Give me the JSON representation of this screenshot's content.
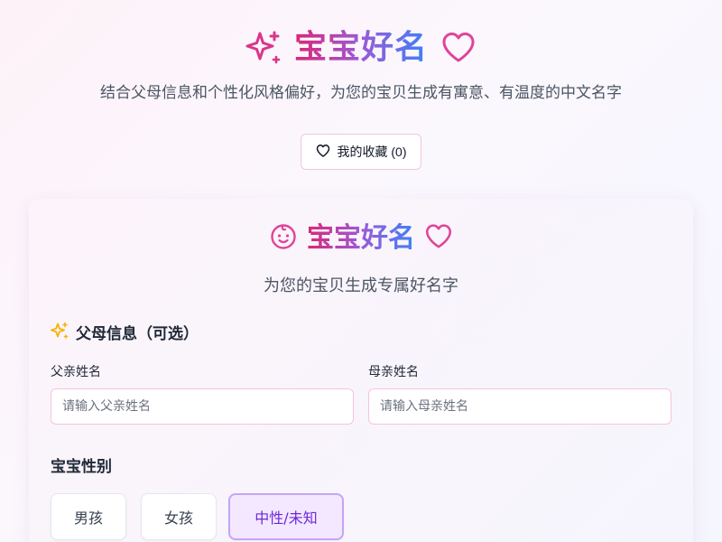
{
  "header": {
    "title": "宝宝好名",
    "subtitle": "结合父母信息和个性化风格偏好，为您的宝贝生成有寓意、有温度的中文名字",
    "favorites_label": "我的收藏 (0)"
  },
  "card": {
    "title": "宝宝好名",
    "subtitle": "为您的宝贝生成专属好名字",
    "parents_section": "父母信息（可选）",
    "father_label": "父亲姓名",
    "father_placeholder": "请输入父亲姓名",
    "father_value": "",
    "mother_label": "母亲姓名",
    "mother_placeholder": "请输入母亲姓名",
    "mother_value": "",
    "gender_section": "宝宝性别",
    "gender_options": [
      {
        "label": "男孩",
        "selected": false
      },
      {
        "label": "女孩",
        "selected": false
      },
      {
        "label": "中性/未知",
        "selected": true
      }
    ]
  },
  "colors": {
    "accent_pink": "#db2777",
    "accent_purple": "#9b5ad6",
    "accent_blue": "#3b82f6",
    "sparkle_yellow": "#f5b301",
    "selected_bg": "#f3e8ff",
    "selected_border": "#c4a5f5",
    "selected_text": "#6d28d9"
  },
  "icons": {
    "hero_left": "sparkles-icon",
    "hero_right": "heart-icon",
    "favorites": "heart-outline-icon",
    "card_left": "baby-face-icon",
    "card_right": "heart-icon",
    "section": "sparkles-icon"
  }
}
